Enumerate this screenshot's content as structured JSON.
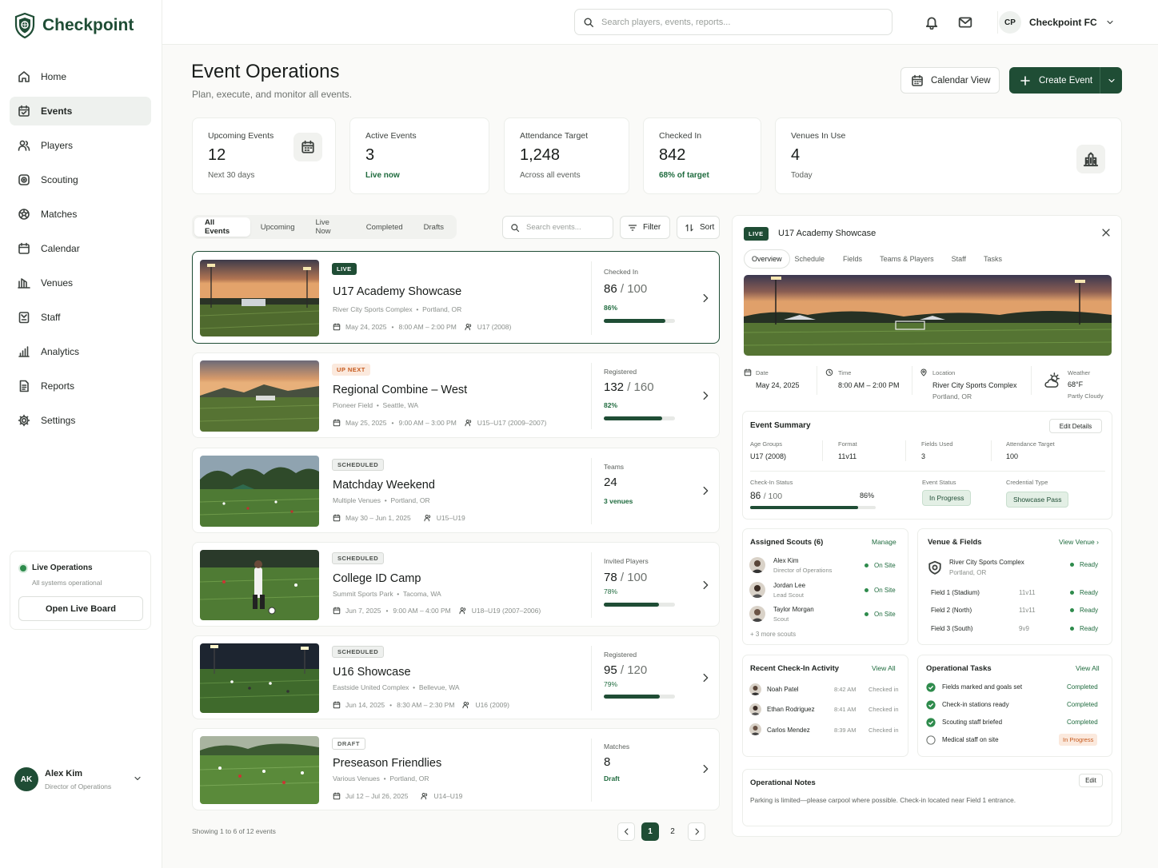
{
  "app": {
    "name": "Checkpoint"
  },
  "sidebar": {
    "items": [
      {
        "label": "Home",
        "icon": "home-icon"
      },
      {
        "label": "Events",
        "icon": "calendar-check-icon",
        "active": true
      },
      {
        "label": "Players",
        "icon": "users-icon"
      },
      {
        "label": "Scouting",
        "icon": "scouting-icon"
      },
      {
        "label": "Matches",
        "icon": "ball-icon"
      },
      {
        "label": "Calendar",
        "icon": "calendar-icon"
      },
      {
        "label": "Venues",
        "icon": "stadium-icon"
      },
      {
        "label": "Staff",
        "icon": "badge-icon"
      },
      {
        "label": "Analytics",
        "icon": "bar-chart-icon"
      },
      {
        "label": "Reports",
        "icon": "document-icon"
      },
      {
        "label": "Settings",
        "icon": "gear-icon"
      }
    ],
    "live_ops": {
      "title": "Live Operations",
      "status": "All systems operational",
      "button": "Open Live Board"
    },
    "user": {
      "initials": "AK",
      "name": "Alex Kim",
      "role": "Director of Operations"
    }
  },
  "topbar": {
    "search_placeholder": "Search players, events, reports...",
    "account": {
      "initials": "CP",
      "name": "Checkpoint FC"
    }
  },
  "page": {
    "title": "Event Operations",
    "subtitle": "Plan, execute, and monitor all events.",
    "calendar_view": "Calendar View",
    "create_event": "Create Event"
  },
  "stats": [
    {
      "label": "Upcoming Events",
      "value": "12",
      "sub": "Next 30 days"
    },
    {
      "label": "Active Events",
      "value": "3",
      "sub": "Live now"
    },
    {
      "label": "Attendance Target",
      "value": "1,248",
      "sub": "Across all events"
    },
    {
      "label": "Checked In",
      "value": "842",
      "sub": "68% of target"
    },
    {
      "label": "Venues In Use",
      "value": "4",
      "sub": "Today"
    }
  ],
  "filters": {
    "tabs": [
      "All Events",
      "Upcoming",
      "Live Now",
      "Completed",
      "Drafts"
    ],
    "active": "All Events",
    "search_placeholder": "Search events...",
    "filter": "Filter",
    "sort": "Sort"
  },
  "events": [
    {
      "badge": "LIVE",
      "name": "U17 Academy Showcase",
      "venue": "River City Sports Complex",
      "city": "Portland, OR",
      "date": "May 24, 2025",
      "time": "8:00 AM – 2:00 PM",
      "group": "U17 (2008)",
      "metric_label": "Checked In",
      "metric_value": "86",
      "metric_of": "/ 100",
      "metric_sub": "86%",
      "progress": 0.86
    },
    {
      "badge": "UP NEXT",
      "name": "Regional Combine – West",
      "venue": "Pioneer Field",
      "city": "Seattle, WA",
      "date": "May 25, 2025",
      "time": "9:00 AM – 3:00 PM",
      "group": "U15–U17 (2009–2007)",
      "metric_label": "Registered",
      "metric_value": "132",
      "metric_of": "/ 160",
      "metric_sub": "82%",
      "progress": 0.82
    },
    {
      "badge": "SCHEDULED",
      "name": "Matchday Weekend",
      "venue": "Multiple Venues",
      "city": "Portland, OR",
      "date": "May 30 – Jun 1, 2025",
      "time": "",
      "group": "U15–U19",
      "metric_label": "Teams",
      "metric_value": "24",
      "metric_of": "",
      "metric_sub": "3 venues",
      "progress": null
    },
    {
      "badge": "SCHEDULED",
      "name": "College ID Camp",
      "venue": "Summit Sports Park",
      "city": "Tacoma, WA",
      "date": "Jun 7, 2025",
      "time": "9:00 AM – 4:00 PM",
      "group": "U18–U19 (2007–2006)",
      "metric_label": "Invited Players",
      "metric_value": "78",
      "metric_of": "/ 100",
      "metric_sub": "78%",
      "progress": 0.78
    },
    {
      "badge": "SCHEDULED",
      "name": "U16 Showcase",
      "venue": "Eastside United Complex",
      "city": "Bellevue, WA",
      "date": "Jun 14, 2025",
      "time": "8:30 AM – 2:30 PM",
      "group": "U16 (2009)",
      "metric_label": "Registered",
      "metric_value": "95",
      "metric_of": "/ 120",
      "metric_sub": "79%",
      "progress": 0.79
    },
    {
      "badge": "DRAFT",
      "name": "Preseason Friendlies",
      "venue": "Various Venues",
      "city": "Portland, OR",
      "date": "Jul 12 – Jul 26, 2025",
      "time": "",
      "group": "U14–U19",
      "metric_label": "Matches",
      "metric_value": "8",
      "metric_of": "",
      "metric_sub": "Draft",
      "progress": null
    }
  ],
  "pagination": {
    "info": "Showing 1 to 6 of 12 events",
    "pages": [
      "1",
      "2"
    ],
    "current": "1"
  },
  "detail": {
    "badge": "LIVE",
    "title": "U17 Academy Showcase",
    "tabs": [
      "Overview",
      "Schedule",
      "Fields",
      "Teams & Players",
      "Staff",
      "Tasks"
    ],
    "active_tab": "Overview",
    "info": {
      "date_label": "Date",
      "date": "May 24, 2025",
      "time_label": "Time",
      "time": "8:00 AM – 2:00 PM",
      "location_label": "Location",
      "location": "River City Sports Complex",
      "location_city": "Portland, OR",
      "weather_label": "Weather",
      "weather_temp": "68°F",
      "weather_desc": "Partly Cloudy"
    },
    "summary": {
      "title": "Event Summary",
      "edit": "Edit Details",
      "age_label": "Age Groups",
      "age": "U17 (2008)",
      "format_label": "Format",
      "format": "11v11",
      "fields_label": "Fields Used",
      "fields": "3",
      "target_label": "Attendance Target",
      "target": "100",
      "checkin_label": "Check-In Status",
      "checkin": "86",
      "checkin_of": "/ 100",
      "checkin_pct": "86%",
      "checkin_progress": 0.86,
      "status_label": "Event Status",
      "status": "In Progress",
      "cred_label": "Credential Type",
      "cred": "Showcase Pass"
    },
    "scouts": {
      "title": "Assigned Scouts (6)",
      "manage": "Manage",
      "list": [
        {
          "name": "Alex Kim",
          "role": "Director of Operations",
          "status": "On Site"
        },
        {
          "name": "Jordan Lee",
          "role": "Lead Scout",
          "status": "On Site"
        },
        {
          "name": "Taylor Morgan",
          "role": "Scout",
          "status": "On Site"
        }
      ],
      "more": "+ 3 more scouts"
    },
    "venue": {
      "title": "Venue & Fields",
      "link": "View Venue",
      "name": "River City Sports Complex",
      "city": "Portland, OR",
      "status": "Ready",
      "fields": [
        {
          "name": "Field 1 (Stadium)",
          "format": "11v11",
          "status": "Ready"
        },
        {
          "name": "Field 2 (North)",
          "format": "11v11",
          "status": "Ready"
        },
        {
          "name": "Field 3 (South)",
          "format": "9v9",
          "status": "Ready"
        }
      ]
    },
    "checkins": {
      "title": "Recent Check-In Activity",
      "link": "View All",
      "list": [
        {
          "name": "Noah Patel",
          "time": "8:42 AM",
          "status": "Checked in"
        },
        {
          "name": "Ethan Rodriguez",
          "time": "8:41 AM",
          "status": "Checked in"
        },
        {
          "name": "Carlos Mendez",
          "time": "8:39 AM",
          "status": "Checked in"
        }
      ]
    },
    "tasks": {
      "title": "Operational Tasks",
      "link": "View All",
      "list": [
        {
          "name": "Fields marked and goals set",
          "status": "Completed",
          "done": true
        },
        {
          "name": "Check-in stations ready",
          "status": "Completed",
          "done": true
        },
        {
          "name": "Scouting staff briefed",
          "status": "Completed",
          "done": true
        },
        {
          "name": "Medical staff on site",
          "status": "In Progress",
          "done": false
        }
      ]
    },
    "notes": {
      "title": "Operational Notes",
      "edit": "Edit",
      "text": "Parking is limited—please carpool where possible. Check-in located near Field 1 entrance."
    }
  }
}
